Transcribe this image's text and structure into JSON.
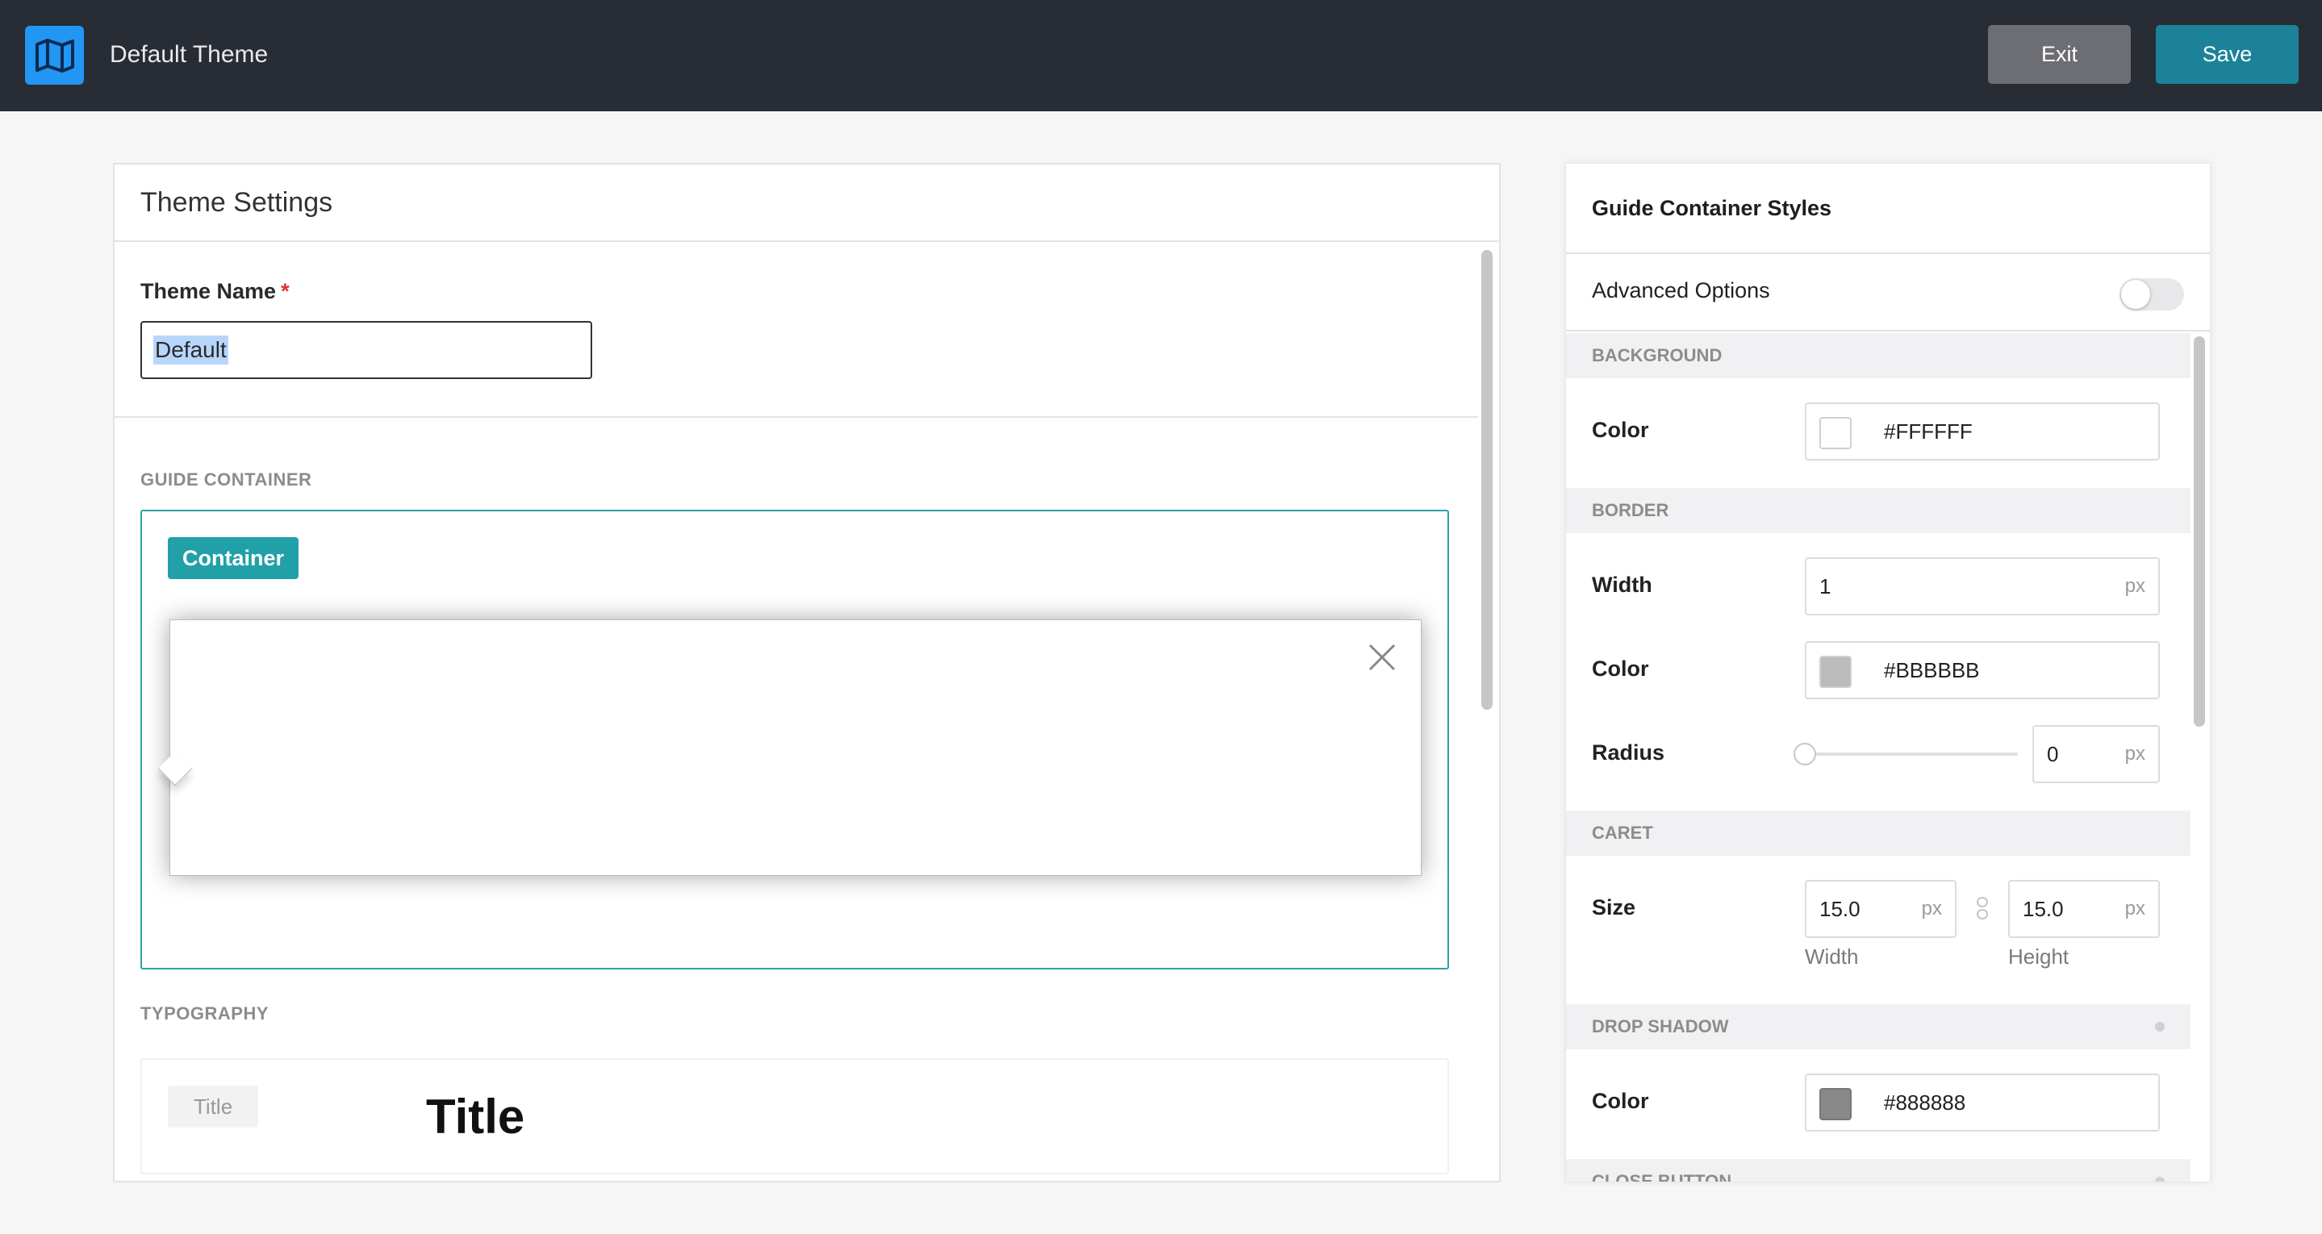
{
  "header": {
    "title": "Default Theme",
    "exit_label": "Exit",
    "save_label": "Save",
    "logo_icon": "map-icon",
    "logo_color": "#2196F3"
  },
  "theme_settings": {
    "title": "Theme Settings",
    "theme_name_label": "Theme Name",
    "required_mark": "*",
    "theme_name_value": "Default",
    "guide_container_heading": "GUIDE CONTAINER",
    "container_chip": "Container",
    "typography_heading": "TYPOGRAPHY",
    "typography_chip": "Title",
    "typography_sample": "Title"
  },
  "styles_panel": {
    "title": "Guide Container Styles",
    "advanced_options_label": "Advanced Options",
    "advanced_options_on": false,
    "background": {
      "heading": "BACKGROUND",
      "color_label": "Color",
      "color_value": "#FFFFFF"
    },
    "border": {
      "heading": "BORDER",
      "width_label": "Width",
      "width_value": "1",
      "width_unit": "px",
      "color_label": "Color",
      "color_value": "#BBBBBB",
      "radius_label": "Radius",
      "radius_value": "0",
      "radius_unit": "px"
    },
    "caret": {
      "heading": "CARET",
      "size_label": "Size",
      "width_value": "15.0",
      "height_value": "15.0",
      "unit": "px",
      "width_caption": "Width",
      "height_caption": "Height"
    },
    "drop_shadow": {
      "heading": "DROP SHADOW",
      "color_label": "Color",
      "color_value": "#888888"
    },
    "close_button": {
      "heading": "CLOSE BUTTON"
    }
  }
}
